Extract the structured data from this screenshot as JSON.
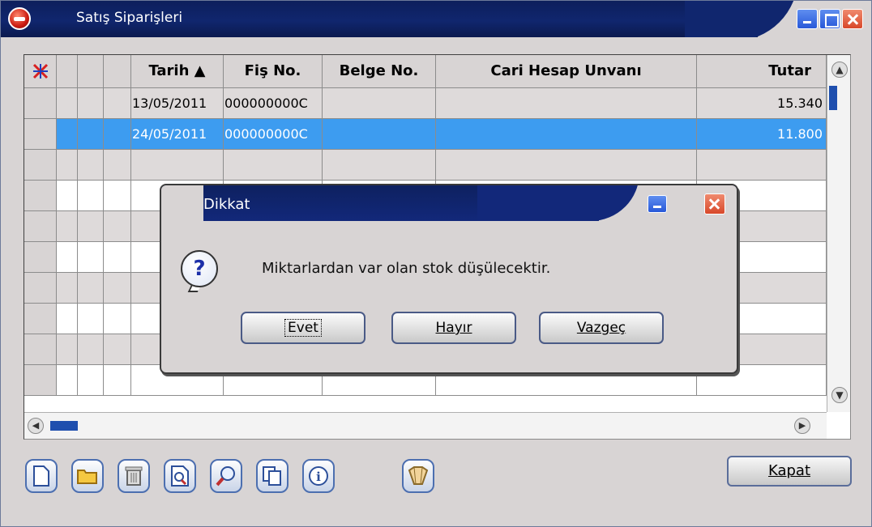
{
  "window": {
    "title": "Satış Siparişleri"
  },
  "grid": {
    "columns": [
      {
        "label": ""
      },
      {
        "label": ""
      },
      {
        "label": ""
      },
      {
        "label": "Tarih ▲"
      },
      {
        "label": "Fiş No."
      },
      {
        "label": "Belge No."
      },
      {
        "label": "Cari Hesap Unvanı"
      },
      {
        "label": "Tutar"
      }
    ],
    "rows": [
      {
        "tarih": "13/05/2011",
        "fis_no": "000000000C",
        "belge_no": "",
        "cari": "",
        "tutar": "15.340"
      },
      {
        "tarih": "24/05/2011",
        "fis_no": "000000000C",
        "belge_no": "",
        "cari": "",
        "tutar": "11.800"
      }
    ]
  },
  "toolbar": {
    "icons": [
      "new-document-icon",
      "open-folder-icon",
      "trash-icon",
      "preview-icon",
      "search-icon",
      "copy-icon",
      "info-icon",
      "filter-icon"
    ],
    "close_label": "Kapat"
  },
  "dialog": {
    "title": "Dikkat",
    "message": "Miktarlardan var olan stok düşülecektir.",
    "buttons": {
      "yes": "Evet",
      "no": "Hayır",
      "cancel": "Vazgeç"
    }
  },
  "colors": {
    "titlebar": "#10266e",
    "selection": "#3d9cf0",
    "scroll_thumb": "#1f4fae"
  }
}
